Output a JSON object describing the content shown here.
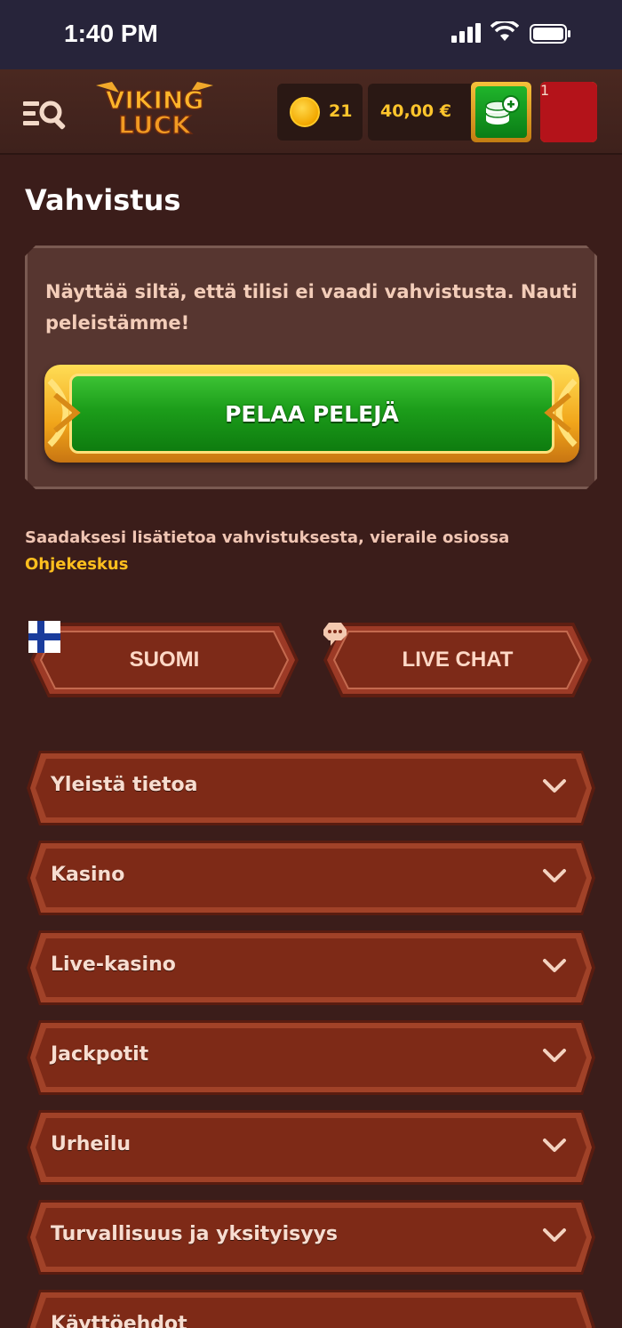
{
  "status_bar": {
    "time": "1:40 PM"
  },
  "header": {
    "logo_text_line1": "VIKING",
    "logo_text_line2": "LUCK",
    "coins": "21",
    "balance": "40,00 €",
    "notification_count": "1",
    "icons": [
      "menu-search-icon",
      "coin-icon",
      "deposit-icon",
      "avatar-icon"
    ]
  },
  "page": {
    "title": "Vahvistus",
    "card_message": "Näyttää siltä, että tilisi ei vaadi vahvistusta. Nauti peleistämme!",
    "play_button": "PELAA PELEJÄ",
    "info_text": "Saadaksesi lisätietoa vahvistuksesta, vieraile osiossa",
    "help_link": "Ohjekeskus"
  },
  "buttons": {
    "language": "SUOMI",
    "live_chat": "LIVE CHAT"
  },
  "accordion": [
    {
      "label": "Yleistä tietoa"
    },
    {
      "label": "Kasino"
    },
    {
      "label": "Live-kasino"
    },
    {
      "label": "Jackpotit"
    },
    {
      "label": "Urheilu"
    },
    {
      "label": "Turvallisuus ja yksityisyys"
    },
    {
      "label": "Käyttöehdot"
    }
  ],
  "colors": {
    "background": "#3b1d1a",
    "accent_gold": "#ffbf1e",
    "play_green": "#1c9d1a",
    "panel_red": "#7d2a18"
  }
}
